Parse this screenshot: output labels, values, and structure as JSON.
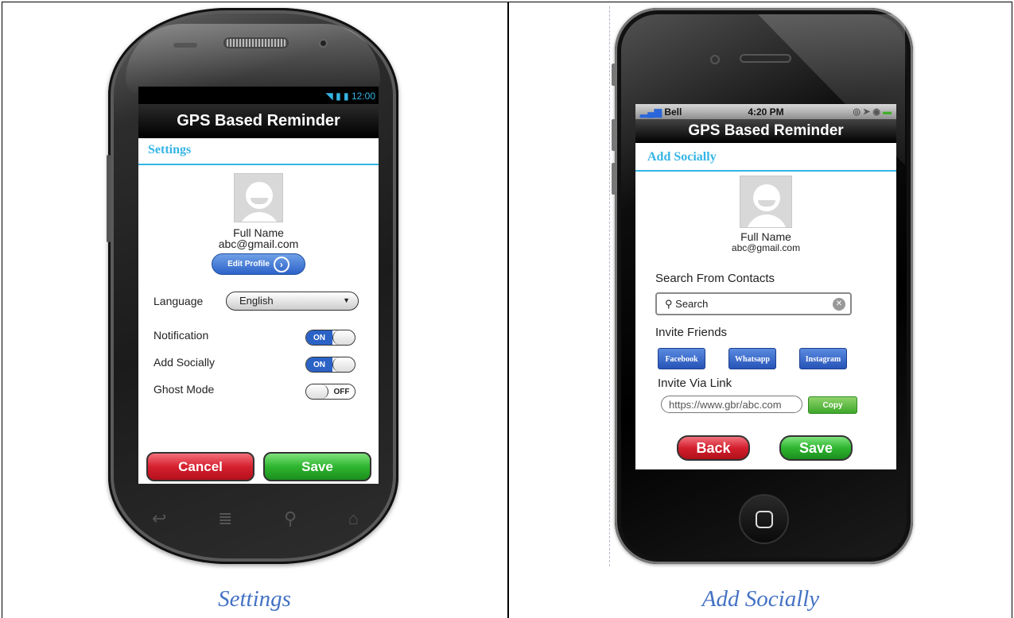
{
  "settings_screen": {
    "status_time": "12:00",
    "title": "GPS Based Reminder",
    "header": "Settings",
    "full_name": "Full Name",
    "email": "abc@gmail.com",
    "edit_profile_label": "Edit Profile",
    "language_label": "Language",
    "language_value": "English",
    "notification_label": "Notification",
    "notification_state": "ON",
    "add_socially_label": "Add Socially",
    "add_socially_state": "ON",
    "ghost_mode_label": "Ghost Mode",
    "ghost_mode_state": "OFF",
    "cancel_label": "Cancel",
    "save_label": "Save"
  },
  "add_socially_screen": {
    "carrier": "Bell",
    "status_time": "4:20 PM",
    "title": "GPS Based Reminder",
    "header": "Add Socially",
    "full_name": "Full Name",
    "email": "abc@gmail.com",
    "search_label": "Search From Contacts",
    "search_placeholder": "Search",
    "invite_friends_label": "Invite Friends",
    "facebook_label": "Facebook",
    "whatsapp_label": "Whatsapp",
    "instagram_label": "Instagram",
    "invite_link_label": "Invite Via Link",
    "link_value": "https://www.gbr/abc.com",
    "copy_label": "Copy",
    "back_label": "Back",
    "save_label": "Save"
  },
  "captions": {
    "left": "Settings",
    "right": "Add Socially"
  }
}
